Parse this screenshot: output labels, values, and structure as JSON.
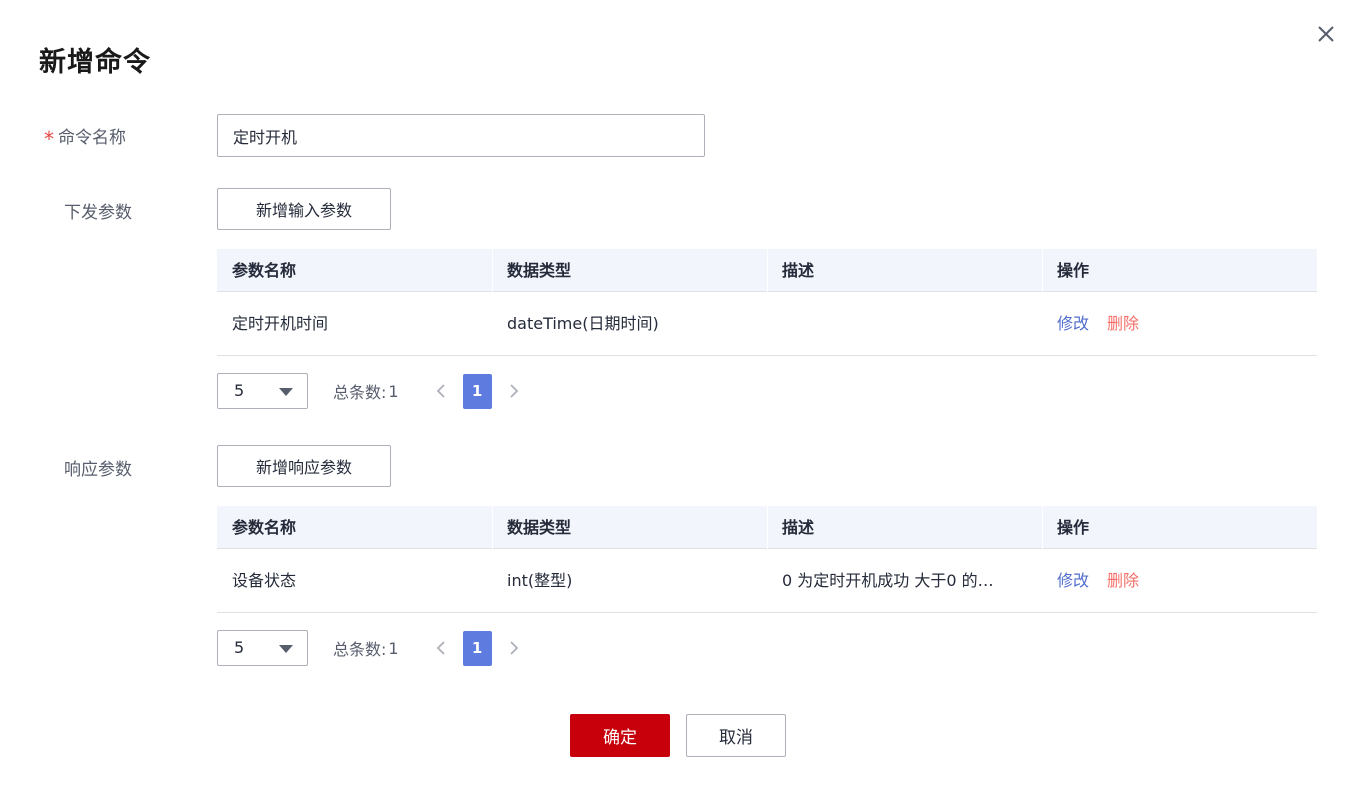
{
  "dialog": {
    "title": "新增命令",
    "close_icon": "close-icon"
  },
  "form": {
    "required_mark": "*",
    "command_name_label": "命令名称",
    "command_name_value": "定时开机",
    "input_params_label": "下发参数",
    "add_input_button": "新增输入参数",
    "response_params_label": "响应参数",
    "add_response_button": "新增响应参数"
  },
  "table_headers": {
    "name": "参数名称",
    "type": "数据类型",
    "desc": "描述",
    "ops": "操作"
  },
  "input_table": {
    "rows": [
      {
        "name": "定时开机时间",
        "type": "dateTime(日期时间)",
        "desc": "",
        "edit": "修改",
        "delete": "删除"
      }
    ],
    "pager": {
      "page_size": "5",
      "total_label": "总条数:",
      "total": "1",
      "current_page": "1"
    }
  },
  "response_table": {
    "rows": [
      {
        "name": "设备状态",
        "type": "int(整型)",
        "desc": "0 为定时开机成功 大于0 的…",
        "edit": "修改",
        "delete": "删除"
      }
    ],
    "pager": {
      "page_size": "5",
      "total_label": "总条数:",
      "total": "1",
      "current_page": "1"
    }
  },
  "footer": {
    "confirm": "确定",
    "cancel": "取消"
  },
  "colors": {
    "primary": "#c7000b",
    "link": "#526ecc",
    "danger": "#f66f6a",
    "pager_active": "#5e7ce0",
    "header_bg": "#f2f5fc"
  }
}
